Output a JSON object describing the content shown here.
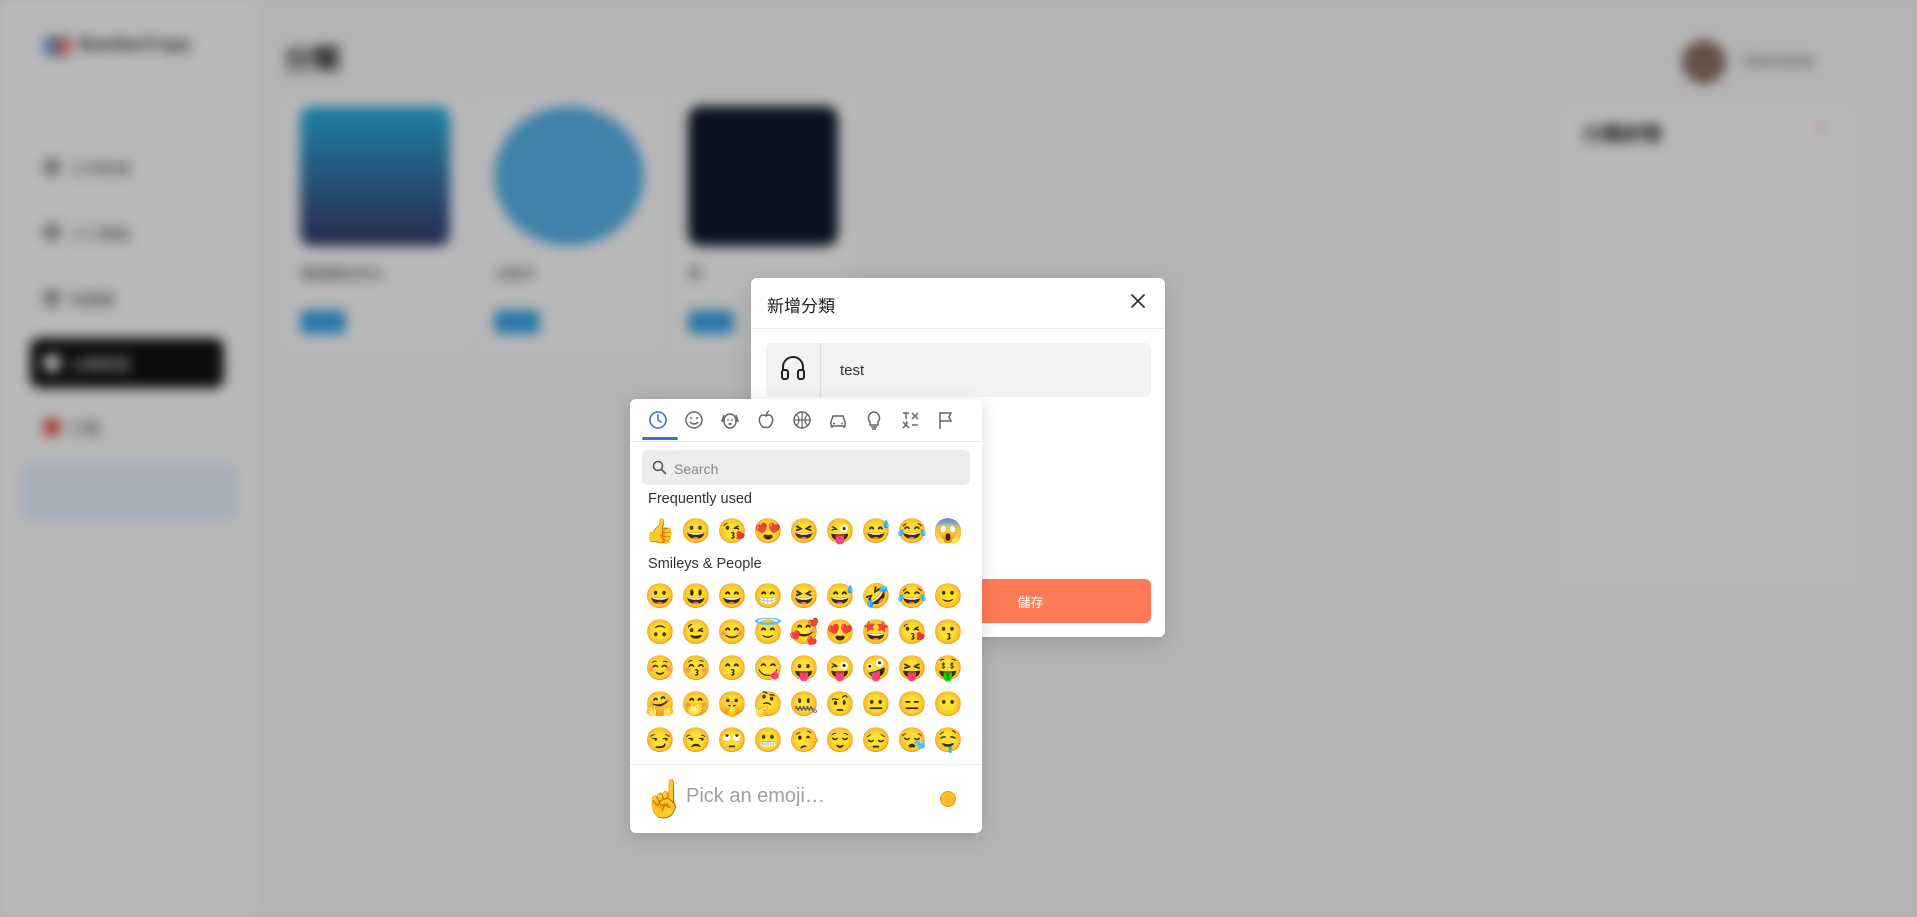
{
  "app": {
    "logo_text": "NumberCopy",
    "page_title": "分類",
    "user_name": "Username",
    "sidebar": {
      "items": [
        {
          "label": "工作區域"
        },
        {
          "label": "人工智能"
        },
        {
          "label": "知識庫"
        },
        {
          "label": "分類管理"
        },
        {
          "label": "訂閱"
        }
      ]
    },
    "cards": [
      {
        "title": "兩個朋友的AI"
      },
      {
        "title": "AI助手"
      },
      {
        "title": "新"
      }
    ],
    "right_panel": {
      "title": "分類詳情",
      "action": "+"
    }
  },
  "dialog": {
    "title": "新增分類",
    "name_value": "test",
    "icon": "headphones-icon",
    "save_label": "儲存"
  },
  "emoji_picker": {
    "search_placeholder": "Search",
    "categories": [
      "frequently-used",
      "smileys-people",
      "animals-nature",
      "food-drink",
      "activity",
      "travel-places",
      "objects",
      "symbols",
      "flags"
    ],
    "frequent_label": "Frequently used",
    "frequent": [
      "👍",
      "😀",
      "😘",
      "😍",
      "😆",
      "😜",
      "😅",
      "😂",
      "😱"
    ],
    "smileys_label": "Smileys & People",
    "smileys": [
      "😀",
      "😃",
      "😄",
      "😁",
      "😆",
      "😅",
      "🤣",
      "😂",
      "🙂",
      "🙃",
      "😉",
      "😊",
      "😇",
      "🥰",
      "😍",
      "🤩",
      "😘",
      "😗",
      "☺️",
      "😚",
      "😙",
      "😋",
      "😛",
      "😜",
      "🤪",
      "😝",
      "🤑",
      "🤗",
      "🤭",
      "🤫",
      "🤔",
      "🤐",
      "🤨",
      "😐",
      "😑",
      "😶",
      "😏",
      "😒",
      "🙄",
      "😬",
      "🤥",
      "😌",
      "😔",
      "😪",
      "🤤"
    ],
    "preview_emoji": "☝️",
    "preview_placeholder": "Pick an emoji…",
    "skin_tone_color": "#ffbd29"
  }
}
